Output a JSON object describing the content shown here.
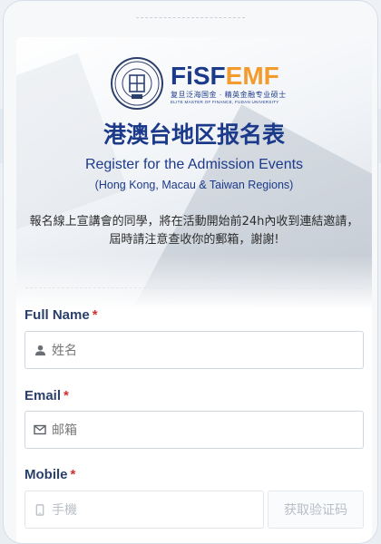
{
  "brand": {
    "mark_part1": "FiSF",
    "mark_part2": "EMF",
    "sub_cn": "复旦泛海国金 · 精英金融专业硕士",
    "sub_en": "ELITE MASTER OF FINANCE, FUDAN UNIVERSITY",
    "seal_year": "1905",
    "accent_color": "#1c3a8a",
    "brand_orange": "#f39b2c"
  },
  "header": {
    "title": "港澳台地区报名表",
    "subtitle": "Register for the Admission Events",
    "subtitle_region": "(Hong Kong, Macau & Taiwan Regions)",
    "notice": "報名線上宣講會的同學，將在活動開始前24h內收到連結邀請，屆時請注意查收你的郵箱，謝謝!"
  },
  "form": {
    "full_name": {
      "label": "Full Name",
      "required_mark": "*",
      "placeholder": "姓名",
      "icon": "user-icon"
    },
    "email": {
      "label": "Email",
      "required_mark": "*",
      "placeholder": "邮箱",
      "icon": "mail-icon"
    },
    "mobile": {
      "label": "Mobile",
      "required_mark": "*",
      "placeholder": "手機",
      "icon": "phone-icon",
      "code_button": "获取验证码"
    }
  }
}
